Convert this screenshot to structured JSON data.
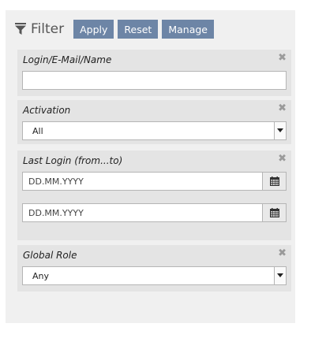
{
  "header": {
    "title": "Filter",
    "apply_label": "Apply",
    "reset_label": "Reset",
    "manage_label": "Manage"
  },
  "login_section": {
    "label": "Login/E-Mail/Name",
    "value": ""
  },
  "activation_section": {
    "label": "Activation",
    "selected": "All"
  },
  "last_login_section": {
    "label": "Last Login (from...to)",
    "from_placeholder": "DD.MM.YYYY",
    "to_placeholder": "DD.MM.YYYY"
  },
  "global_role_section": {
    "label": "Global Role",
    "selected": "Any"
  },
  "icons": {
    "filter": "filter-icon",
    "close": "close-icon",
    "calendar": "calendar-icon",
    "dropdown": "dropdown-arrow-icon"
  },
  "colors": {
    "button_bg": "#6d85a6",
    "panel_bg": "#f0f0f0",
    "section_bg": "#e4e4e4"
  }
}
